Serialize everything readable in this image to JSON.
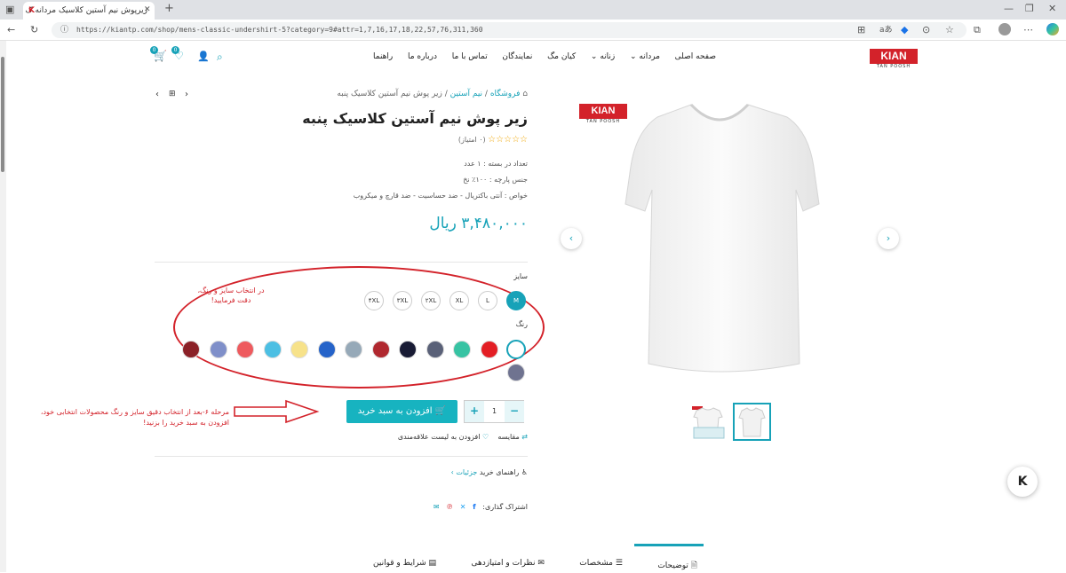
{
  "browser": {
    "tab_title": "زیرپوش نیم آستین کلاسیک مردانه ک",
    "favicon": "K",
    "new_tab": "+",
    "url": "https://kiantp.com/shop/mens-classic-undershirt-5?category=9#attr=1,7,16,17,18,22,57,76,311,360"
  },
  "header": {
    "logo": "KIAN",
    "logo_sub": "TAN POOSH",
    "nav": [
      "صفحه اصلی",
      "مردانه",
      "زنانه",
      "کیان مگ",
      "نمایندگان",
      "تماس با ما",
      "درباره ما",
      "راهنما"
    ],
    "cart_count": "0",
    "wish_count": "0"
  },
  "breadcrumb": {
    "home": "فروشگاه",
    "cat": "نیم آستین",
    "current": "زیر پوش نیم آستین کلاسیک پنبه"
  },
  "product": {
    "title": "زیر پوش نیم آستین کلاسیک پنبه",
    "stars": "☆☆☆☆☆",
    "rating_text": "(۰ امتیاز)",
    "attrs": [
      "تعداد در بسته : ۱ عدد",
      "جنس پارچه : ۱۰۰٪ نخ",
      "خواص : آنتی باکتریال - ضد حساسیت - ضد قارچ و میکروب"
    ],
    "price": "۳,۴۸۰,۰۰۰ ریال",
    "size_label": "سایز",
    "sizes": [
      "M",
      "L",
      "XL",
      "۲XL",
      "۳XL",
      "۴XL"
    ],
    "color_label": "رنگ",
    "colors": [
      "#ffffff",
      "#e31e24",
      "#37c3a3",
      "#5a6178",
      "#181b34",
      "#b0282f",
      "#96a9b8",
      "#2563c9",
      "#f7e28a",
      "#4cbfe3",
      "#ee5a5e",
      "#7f8fc9",
      "#8b2127",
      "#6f7390"
    ],
    "qty": "1",
    "minus": "−",
    "plus": "+",
    "add_to_cart": "افزودن به سبد خرید",
    "compare": "مقایسه",
    "wishlist": "افزودن به لیست علاقه‌مندی",
    "guide": "راهنمای خرید",
    "details": "جزئیات",
    "share": "اشتراک گذاری:",
    "image_logo": "KIAN",
    "image_logo_sub": "TAN POOSH"
  },
  "annotations": {
    "note1": "در انتخاب سایز و رنگ، دقت فرمایید!",
    "note2": "مرحله ۶-بعد از انتخاب دقیق سایز و رنگ محصولات انتخابی خود، افزودن به سبد خرید را بزنید!"
  },
  "tabs": [
    "توضیحات",
    "مشخصات",
    "نظرات و امتیازدهی",
    "شرایط و قوانین"
  ],
  "colors": {
    "accent": "#17a2b8",
    "annotation": "#d3222a"
  }
}
